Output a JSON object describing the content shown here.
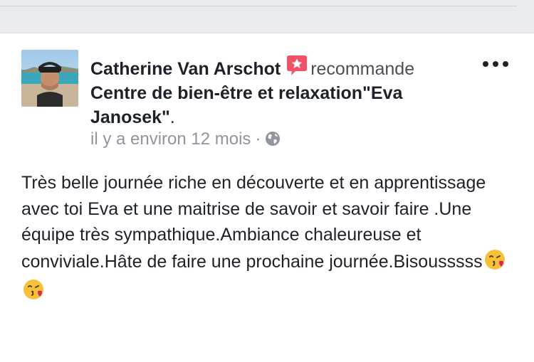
{
  "post": {
    "author_name": "Catherine Van Arschot",
    "action_text": "recommande",
    "page_name": "Centre de bien-être et relaxation\"Eva Janosek\"",
    "page_suffix": ".",
    "timestamp": "il y a environ 12 mois",
    "separator": "·",
    "privacy_icon": "globe-icon",
    "recommend_icon": "recommendation-star-icon",
    "more_icon": "more-options-icon",
    "body": "Très belle journée riche en découverte et en apprentissage avec toi Eva et une maitrise de savoir et savoir faire .Une équipe très sympathique.Ambiance chaleureuse et conviviale.Hâte de faire une prochaine journée.Bisousssss",
    "emojis": [
      "face-blowing-kiss-emoji",
      "face-blowing-kiss-emoji"
    ]
  },
  "colors": {
    "badge": "#f25268",
    "text": "#1d2129",
    "meta": "#90949c",
    "background": "#e9ebee"
  }
}
